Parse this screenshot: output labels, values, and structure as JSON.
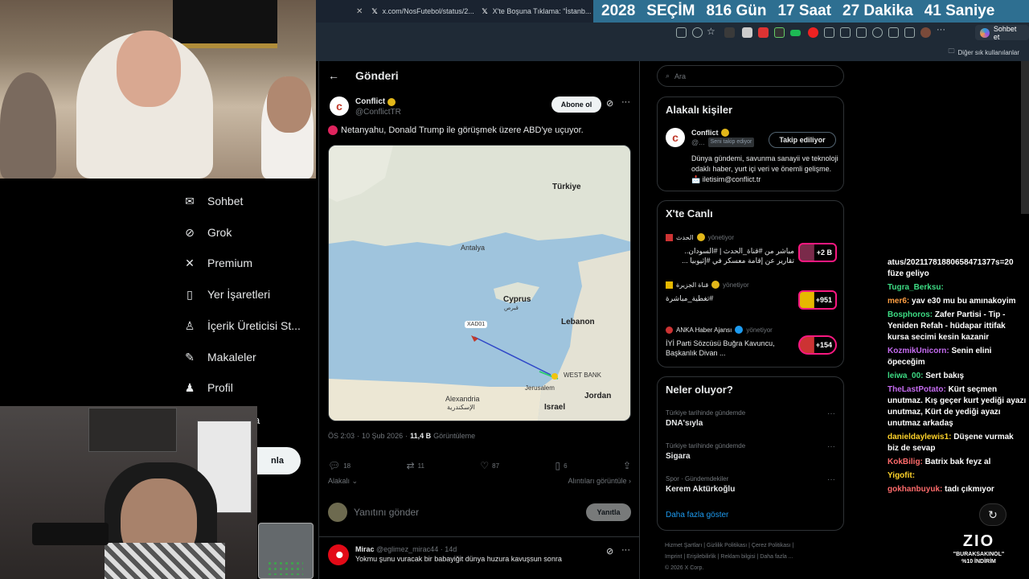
{
  "browser": {
    "tabs": [
      {
        "label": "x.com/NosFutebol/status/2..."
      },
      {
        "label": "X'te Boşuna Tıklama: \"İstanb..."
      }
    ],
    "countdown": {
      "year": "2028",
      "label": "SEÇİM",
      "days": "816 Gün",
      "hours": "17 Saat",
      "minutes": "27 Dakika",
      "seconds": "41 Saniye"
    },
    "chat_button": "Sohbet et",
    "bookmarks_label": "Diğer sık kullanılanlar"
  },
  "nav": {
    "items": [
      {
        "label": "Sohbet",
        "icon": "mail-icon"
      },
      {
        "label": "Grok",
        "icon": "grok-icon"
      },
      {
        "label": "Premium",
        "icon": "x-logo-icon"
      },
      {
        "label": "Yer İşaretleri",
        "icon": "bookmark-icon"
      },
      {
        "label": "İçerik Üreticisi St...",
        "icon": "creator-icon"
      },
      {
        "label": "Makaleler",
        "icon": "article-icon"
      },
      {
        "label": "Profil",
        "icon": "profile-icon"
      }
    ],
    "post_button": "nla",
    "partial_a": "a"
  },
  "post": {
    "header_title": "Gönderi",
    "author_name": "Conflict",
    "author_handle": "@ConflictTR",
    "subscribe_label": "Abone ol",
    "text": "Netanyahu, Donald Trump ile görüşmek üzere ABD'ye uçuyor.",
    "map": {
      "labels": [
        "Türkiye",
        "Antalya",
        "Cyprus",
        "Lebanon",
        "WEST BANK",
        "Jerusalem",
        "Jordan",
        "Israel",
        "Alexandria",
        "XAD01"
      ],
      "arabic": [
        "قبرص",
        "الإسكندرية"
      ]
    },
    "time": "ÖS 2:03",
    "date": "10 Şub 2026",
    "views_count": "11,4 B",
    "views_label": "Görüntüleme",
    "replies": "18",
    "reposts": "11",
    "likes": "87",
    "bookmarks": "6",
    "sort_label": "Alakalı",
    "quotes_label": "Alıntıları görüntüle",
    "reply_placeholder": "Yanıtını gönder",
    "reply_button": "Yanıtla"
  },
  "reply": {
    "name": "Mirac",
    "handle": "@eglimez_mirac44",
    "time": "14d",
    "text": "Yokmu şunu vuracak bir babayiğit dünya huzura kavuşsun sonra"
  },
  "sidebar": {
    "search_placeholder": "Ara",
    "related": {
      "title": "Alakalı kişiler",
      "name": "Conflict",
      "handle": "@...",
      "follows_you": "Seni takip ediyor",
      "follow_button": "Takip ediliyor",
      "bio": "Dünya gündemi, savunma sanayii ve teknoloji odaklı haber, yurt içi veri ve önemli gelişme. 📩 iletisim@conflict.tr"
    },
    "live": {
      "title": "X'te Canlı",
      "items": [
        {
          "source": "الحدث",
          "host": "yönetiyor",
          "title": "مباشر من #قناة_الحدث | #السودان.. تقارير عن إقامة معسكر في #إثيوبيا ...",
          "count": "+2 B"
        },
        {
          "source": "قناة الجزيرة",
          "host": "yönetiyor",
          "title": "تغطية_مباشرة#",
          "count": "+951"
        },
        {
          "source": "ANKA Haber Ajansı",
          "host": "yönetiyor",
          "title": "İYİ Parti Sözcüsü Buğra Kavuncu, Başkanlık Divan ...",
          "count": "+154"
        }
      ]
    },
    "trends": {
      "title": "Neler oluyor?",
      "items": [
        {
          "category": "Türkiye tarihinde gündemde",
          "name": "DNA'sıyla"
        },
        {
          "category": "Türkiye tarihinde gündemde",
          "name": "Sigara"
        },
        {
          "category": "Spor · Gündemdekiler",
          "name": "Kerem Aktürkoğlu"
        }
      ],
      "show_more": "Daha fazla göster"
    },
    "footer": [
      "Hizmet Şartları",
      "Gizlilik Politikası",
      "Çerez Politikası",
      "Imprint",
      "Erişilebilirlik",
      "Reklam bilgisi",
      "Daha fazla ...",
      "© 2026 X Corp."
    ]
  },
  "stream_chat": {
    "messages": [
      {
        "user": "",
        "text": "atus/20211781880658471377s=20 füze geliyo",
        "color": "#ffffff"
      },
      {
        "user": "Tugra_Berksu:",
        "text": "",
        "color": "#3ddc84"
      },
      {
        "user": "mer6:",
        "text": "yav e30 mu bu amınakoyim",
        "color": "#ff9f43"
      },
      {
        "user": "Bosphoros:",
        "text": "Zafer Partisi - Tip - Yeniden Refah - hüdapar ittifak kursa secimi kesin kazanir",
        "color": "#3ddc84"
      },
      {
        "user": "KozmikUnicorn:",
        "text": "Senin elini öpeceğim",
        "color": "#c56cf0"
      },
      {
        "user": "leiwa_00:",
        "text": "Sert bakış",
        "color": "#3ddc84"
      },
      {
        "user": "TheLastPotato:",
        "text": "Kürt seçmen unutmaz. Kış geçer kurt yediği ayazı unutmaz, Kürt de yediği ayazı unutmaz arkadaş",
        "color": "#c56cf0"
      },
      {
        "user": "danieldaylewis1:",
        "text": "Düşene vurmak biz de sevap",
        "color": "#ffd32a"
      },
      {
        "user": "KokBilig:",
        "text": "Batrix bak feyz al",
        "color": "#ff6b6b"
      },
      {
        "user": "Yigofit:",
        "text": "",
        "color": "#ffd32a"
      },
      {
        "user": "gokhanbuyuk:",
        "text": "tadı çıkmıyor",
        "color": "#ff6b6b"
      }
    ]
  },
  "overlay": {
    "logo": "ZIO",
    "promo_code": "\"BURAKSAKINOL\"",
    "discount": "%10 İNDİRİM"
  }
}
